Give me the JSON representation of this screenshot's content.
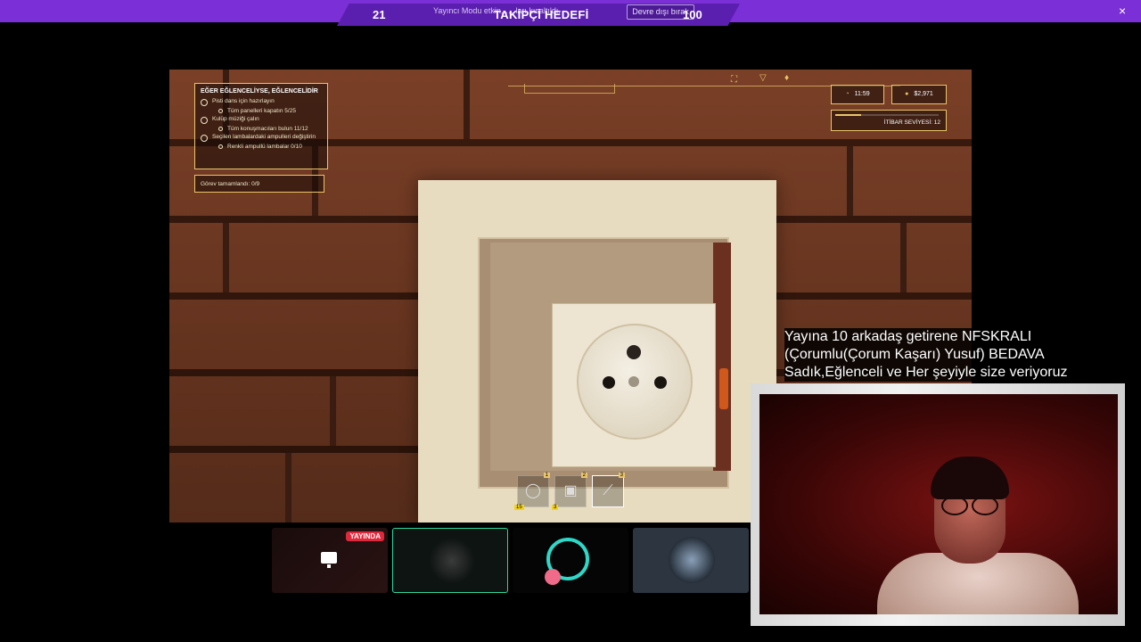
{
  "banner": {
    "goal_current": "21",
    "goal_target": "100",
    "goal_title": "TAKİPÇİ HEDEFİ",
    "streamer_mode_note": "Yayıncı Modu etkin, … ları kısaltıldı.",
    "disable_button": "Devre dışı bırak",
    "close_icon": "×"
  },
  "game": {
    "quest": {
      "title": "EĞER EĞLENCELİYSE, EĞLENCELİDİR",
      "items": [
        {
          "label": "Pisti dans için hazırlayın",
          "sub": "Tüm panelleri kapatın 5/25"
        },
        {
          "label": "Kulüp müziği çalın",
          "sub": "Tüm konuşmacıları bulun 11/12"
        },
        {
          "label": "Seçilen lambalardaki ampulleri değiştirin",
          "sub": "Renkli ampullü lambalar 0/10"
        }
      ],
      "progress": "Görev tamamlandı: 0/9"
    },
    "hud": {
      "time": "11:59",
      "money": "$2,971",
      "reputation_label": "İTİBAR SEVİYESİ:",
      "reputation_value": "12",
      "reputation_progress": 0.25
    },
    "hotbar": [
      {
        "num": "1",
        "count": "15",
        "icon": "cable-icon",
        "glyph": "◯",
        "active": false
      },
      {
        "num": "2",
        "count": "3",
        "icon": "socket-icon",
        "glyph": "▣",
        "active": false
      },
      {
        "num": "3",
        "count": "",
        "icon": "screwdriver-icon",
        "glyph": "⟋",
        "active": true
      }
    ]
  },
  "thumbnails": {
    "live_badge": "YAYINDA",
    "accent": "#2ed8a0"
  },
  "promo": {
    "line1": "Yayına 10 arkadaş getirene NFSKRALI",
    "line2": " (Çorumlu(Çorum Kaşarı) Yusuf) BEDAVA",
    "line3": " Sadık,Eğlenceli ve Her şeyiyle size veriyoruz"
  }
}
